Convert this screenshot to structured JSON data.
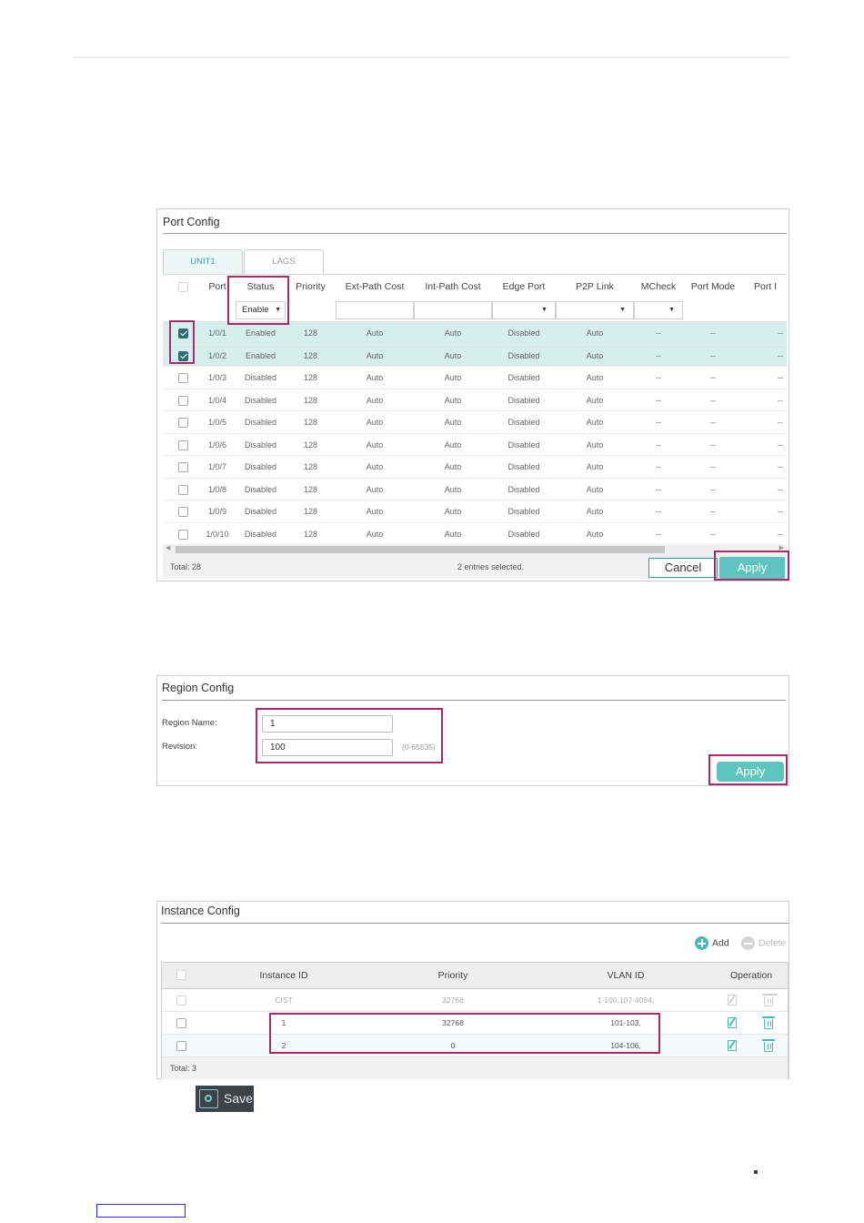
{
  "port_config": {
    "title": "Port Config",
    "tabs": [
      "UNIT1",
      "LAGS"
    ],
    "columns": [
      "Port",
      "Status",
      "Priority",
      "Ext-Path Cost",
      "Int-Path Cost",
      "Edge Port",
      "P2P Link",
      "MCheck",
      "Port Mode",
      "Port I"
    ],
    "status_filter_value": "Enable",
    "rows": [
      {
        "port": "1/0/1",
        "status": "Enabled",
        "priority": "128",
        "ext": "Auto",
        "int": "Auto",
        "edge": "Disabled",
        "p2p": "Auto",
        "mcheck": "--",
        "mode": "--",
        "role": "--",
        "checked": true
      },
      {
        "port": "1/0/2",
        "status": "Enabled",
        "priority": "128",
        "ext": "Auto",
        "int": "Auto",
        "edge": "Disabled",
        "p2p": "Auto",
        "mcheck": "--",
        "mode": "--",
        "role": "--",
        "checked": true
      },
      {
        "port": "1/0/3",
        "status": "Disabled",
        "priority": "128",
        "ext": "Auto",
        "int": "Auto",
        "edge": "Disabled",
        "p2p": "Auto",
        "mcheck": "--",
        "mode": "--",
        "role": "--",
        "checked": false
      },
      {
        "port": "1/0/4",
        "status": "Disabled",
        "priority": "128",
        "ext": "Auto",
        "int": "Auto",
        "edge": "Disabled",
        "p2p": "Auto",
        "mcheck": "--",
        "mode": "--",
        "role": "--",
        "checked": false
      },
      {
        "port": "1/0/5",
        "status": "Disabled",
        "priority": "128",
        "ext": "Auto",
        "int": "Auto",
        "edge": "Disabled",
        "p2p": "Auto",
        "mcheck": "--",
        "mode": "--",
        "role": "--",
        "checked": false
      },
      {
        "port": "1/0/6",
        "status": "Disabled",
        "priority": "128",
        "ext": "Auto",
        "int": "Auto",
        "edge": "Disabled",
        "p2p": "Auto",
        "mcheck": "--",
        "mode": "--",
        "role": "--",
        "checked": false
      },
      {
        "port": "1/0/7",
        "status": "Disabled",
        "priority": "128",
        "ext": "Auto",
        "int": "Auto",
        "edge": "Disabled",
        "p2p": "Auto",
        "mcheck": "--",
        "mode": "--",
        "role": "--",
        "checked": false
      },
      {
        "port": "1/0/8",
        "status": "Disabled",
        "priority": "128",
        "ext": "Auto",
        "int": "Auto",
        "edge": "Disabled",
        "p2p": "Auto",
        "mcheck": "--",
        "mode": "--",
        "role": "--",
        "checked": false
      },
      {
        "port": "1/0/9",
        "status": "Disabled",
        "priority": "128",
        "ext": "Auto",
        "int": "Auto",
        "edge": "Disabled",
        "p2p": "Auto",
        "mcheck": "--",
        "mode": "--",
        "role": "--",
        "checked": false
      },
      {
        "port": "1/0/10",
        "status": "Disabled",
        "priority": "128",
        "ext": "Auto",
        "int": "Auto",
        "edge": "Disabled",
        "p2p": "Auto",
        "mcheck": "--",
        "mode": "--",
        "role": "--",
        "checked": false
      }
    ],
    "total": "Total: 28",
    "selected": "2 entries selected.",
    "cancel_label": "Cancel",
    "apply_label": "Apply"
  },
  "region_config": {
    "title": "Region Config",
    "name_label": "Region Name:",
    "name_value": "1",
    "revision_label": "Revision:",
    "revision_value": "100",
    "revision_hint": "(0-65535)",
    "apply_label": "Apply"
  },
  "instance_config": {
    "title": "Instance Config",
    "add_label": "Add",
    "delete_label": "Delete",
    "columns": [
      "Instance ID",
      "Priority",
      "VLAN ID",
      "Operation"
    ],
    "rows": [
      {
        "id": "CIST",
        "priority": "32768",
        "vlan": "1-100,107-4094,"
      },
      {
        "id": "1",
        "priority": "32768",
        "vlan": "101-103,"
      },
      {
        "id": "2",
        "priority": "0",
        "vlan": "104-106,"
      }
    ],
    "total": "Total: 3"
  },
  "save_label": "Save",
  "colors": {
    "accent": "#5dc4c0",
    "highlight": "#a62b6b",
    "selected_row": "#d6efed",
    "checkbox_on": "#2f6f73"
  }
}
